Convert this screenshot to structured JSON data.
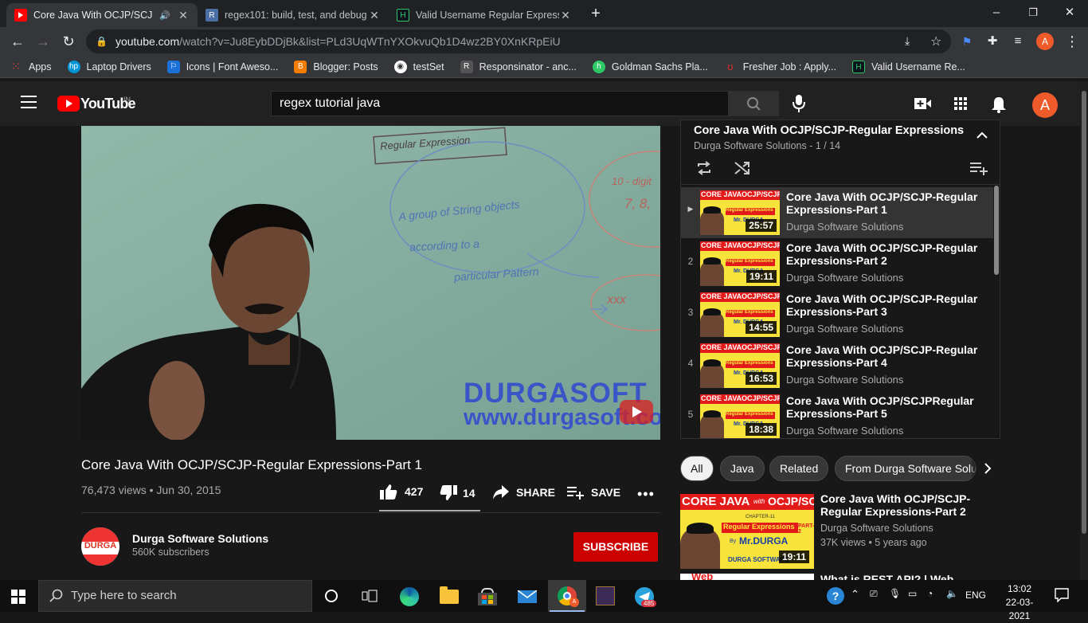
{
  "browser": {
    "tabs": [
      {
        "title": "Core Java With OCJP/SCJP-R",
        "active": true
      },
      {
        "title": "regex101: build, test, and debug",
        "active": false
      },
      {
        "title": "Valid Username Regular Expressi",
        "active": false
      }
    ],
    "url_host": "youtube.com",
    "url_path": "/watch?v=Ju8EybDDjBk&list=PLd3UqWTnYXOkvuQb1D4wz2BY0XnKRpEiU",
    "profile_initial": "A",
    "bookmarks": [
      {
        "label": "Apps",
        "color": "#4285f4"
      },
      {
        "label": "Laptop Drivers",
        "color": "#0096d6"
      },
      {
        "label": "Icons | Font Aweso...",
        "color": "#1c71d8"
      },
      {
        "label": "Blogger: Posts",
        "color": "#f57d00"
      },
      {
        "label": "testSet",
        "color": "#ffffff"
      },
      {
        "label": "Responsinator - anc...",
        "color": "#555555"
      },
      {
        "label": "Goldman Sachs Pla...",
        "color": "#2ec866"
      },
      {
        "label": "Fresher Job : Apply...",
        "color": "#d93025"
      },
      {
        "label": "Valid Username Re...",
        "color": "#222222"
      }
    ]
  },
  "youtube": {
    "logo_text": "YouTube",
    "country": "IN",
    "search_value": "regex tutorial java",
    "avatar_initial": "A",
    "accent": "#ff0000"
  },
  "video": {
    "board_text_1": "Regular Expression",
    "board_text_2": "A group of String objects",
    "board_text_3": "according to a",
    "board_text_4": "particular Pattern",
    "board_text_5": "10 - digit",
    "board_text_6": "7, 8,",
    "board_text_7": "xxx",
    "watermark_1": "DURGASOFT",
    "watermark_2": "www.durgasoft.com",
    "title": "Core Java With OCJP/SCJP-Regular Expressions-Part 1",
    "views": "76,473 views",
    "date": "Jun 30, 2015",
    "likes": "427",
    "dislikes": "14",
    "share_label": "SHARE",
    "save_label": "SAVE",
    "channel": "Durga Software Solutions",
    "subscribers": "560K subscribers",
    "subscribe_label": "SUBSCRIBE",
    "channel_avatar_text": "DURGA"
  },
  "playlist": {
    "title": "Core Java With OCJP/SCJP-Regular Expressions",
    "subtitle": "Durga Software Solutions - 1 / 14",
    "items": [
      {
        "index": "▶",
        "title": "Core Java With OCJP/SCJP-Regular Expressions-Part 1",
        "channel": "Durga Software Solutions",
        "duration": "25:57",
        "active": true
      },
      {
        "index": "2",
        "title": "Core Java With OCJP/SCJP-Regular Expressions-Part 2",
        "channel": "Durga Software Solutions",
        "duration": "19:11",
        "active": false
      },
      {
        "index": "3",
        "title": "Core Java With OCJP/SCJP-Regular Expressions-Part 3",
        "channel": "Durga Software Solutions",
        "duration": "14:55",
        "active": false
      },
      {
        "index": "4",
        "title": "Core Java With OCJP/SCJP-Regular Expressions-Part 4",
        "channel": "Durga Software Solutions",
        "duration": "16:53",
        "active": false
      },
      {
        "index": "5",
        "title": "Core Java With OCJP/SCJPRegular Expressions-Part 5",
        "channel": "Durga Software Solutions",
        "duration": "18:38",
        "active": false
      }
    ],
    "thumb_line_1": "CORE JAVA",
    "thumb_line_2": "OCJP/SCJP",
    "thumb_line_3": "Regular Expressions",
    "thumb_line_4": "Mr. DURGA"
  },
  "chips": [
    {
      "label": "All",
      "selected": true
    },
    {
      "label": "Java",
      "selected": false
    },
    {
      "label": "Related",
      "selected": false
    },
    {
      "label": "From Durga Software Solutions",
      "selected": false
    }
  ],
  "recommended": [
    {
      "title_line_1": "Core Java With OCJP/SCJP-",
      "title_line_2": "Regular Expressions-Part 2",
      "channel": "Durga Software Solutions",
      "meta": "37K views • 5 years ago",
      "duration": "19:11",
      "thumb_top": "CORE JAVA",
      "thumb_with": "with",
      "thumb_ocjp": "OCJP/SCJP",
      "thumb_chapter": "CHAPTER-11",
      "thumb_regex": "Regular Expressions",
      "thumb_part": "PART-2",
      "thumb_by": "By",
      "thumb_mr": "Mr.DURGA",
      "thumb_bottom": "DURGA SOFTWARE"
    },
    {
      "title_line_1": "What is REST API? | Web",
      "thumb_top": "Web"
    }
  ],
  "taskbar": {
    "search_placeholder": "Type here to search",
    "language": "ENG",
    "time": "13:02",
    "date": "22-03-2021",
    "telegram_badge": "485"
  }
}
